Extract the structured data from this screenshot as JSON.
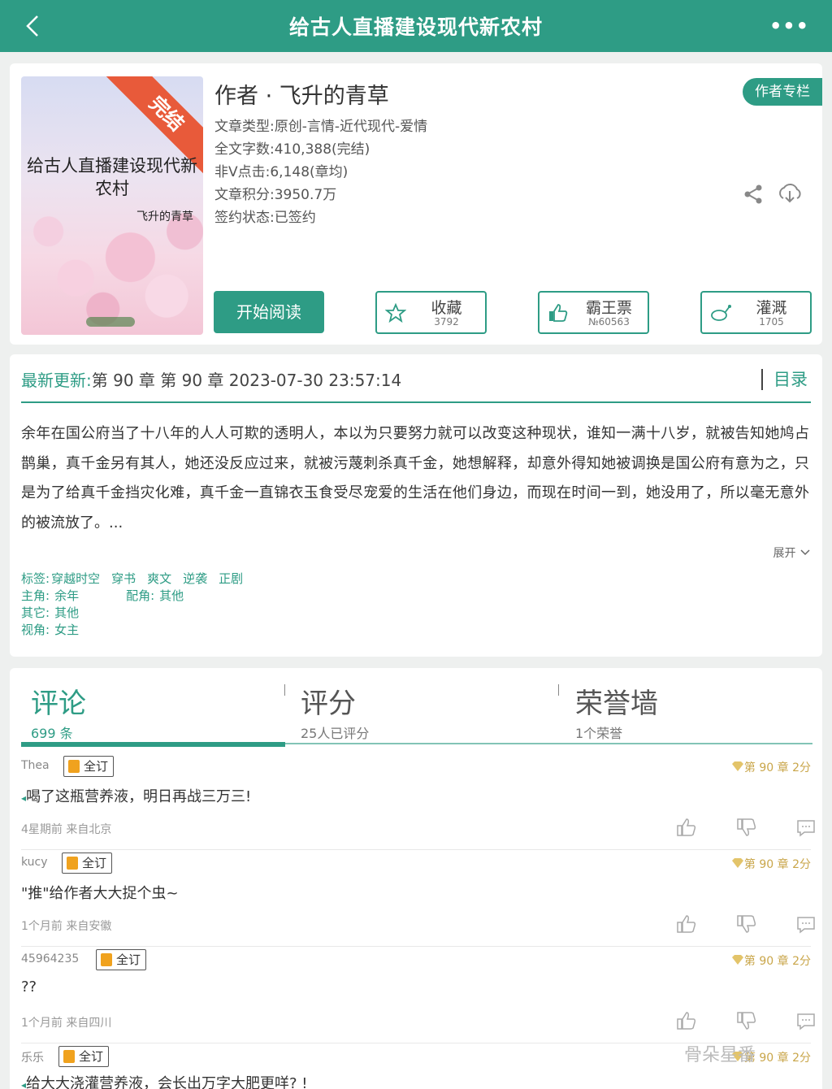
{
  "header": {
    "title": "给古人直播建设现代新农村",
    "back_icon": "chevron-left-icon",
    "more_label": "•••"
  },
  "book": {
    "cover_ribbon": "完结",
    "cover_title": "给古人直播建设现代新农村",
    "cover_author": "飞升的青草",
    "author_line": "作者 · 飞升的青草",
    "author_column_label": "作者专栏",
    "meta": [
      "文章类型:原创-言情-近代现代-爱情",
      "全文字数:410,388(完结)",
      "非V点击:6,148(章均)",
      "文章积分:3950.7万",
      "签约状态:已签约"
    ],
    "read_button": "开始阅读",
    "actions": [
      {
        "label": "收藏",
        "value": "3792",
        "icon": "star-icon"
      },
      {
        "label": "霸王票",
        "value": "№60563",
        "icon": "thumbs-up-icon"
      },
      {
        "label": "灌溉",
        "value": "1705",
        "icon": "watering-can-icon"
      }
    ]
  },
  "update": {
    "label": "最新更新:",
    "text": "第 90 章 第 90 章 2023-07-30 23:57:14",
    "toc": "目录",
    "summary": "余年在国公府当了十八年的人人可欺的透明人，本以为只要努力就可以改变这种现状，谁知一满十八岁，就被告知她鸠占鹊巢，真千金另有其人，她还没反应过来，就被污蔑刺杀真千金，她想解释，却意外得知她被调换是国公府有意为之，只是为了给真千金挡灾化难，真千金一直锦衣玉食受尽宠爱的生活在他们身边，而现在时间一到，她没用了，所以毫无意外的被流放了。...",
    "expand": "展开",
    "tags_label": "标签:",
    "tags": [
      "穿越时空",
      "穿书",
      "爽文",
      "逆袭",
      "正剧"
    ],
    "lead_label": "主角:",
    "lead": "余年",
    "support_label": "配角:",
    "support": "其他",
    "other_label": "其它:",
    "other": "其他",
    "view_label": "视角:",
    "view": "女主"
  },
  "tabs": [
    {
      "name": "评论",
      "sub": "699 条"
    },
    {
      "name": "评分",
      "sub": "25人已评分"
    },
    {
      "name": "荣誉墙",
      "sub": "1个荣誉"
    }
  ],
  "comments": [
    {
      "user": "Thea",
      "badge": "全订",
      "text": "喝了这瓶营养液，明日再战三万三!",
      "time": "4星期前  来自北京",
      "chapter": "第 90 章 2分"
    },
    {
      "user": "kucy",
      "badge": "全订",
      "text": "\"推\"给作者大大捉个虫~",
      "time": "1个月前  来自安徽",
      "chapter": "第 90 章 2分"
    },
    {
      "user": "45964235",
      "badge": "全订",
      "text": "??",
      "time": "1个月前  来自四川",
      "chapter": "第 90 章 2分"
    },
    {
      "user": "乐乐",
      "badge": "全订",
      "text": "给大大浇灌营养液，会长出万字大肥更咩? !",
      "time": "",
      "chapter": "第 90 章 2分"
    }
  ],
  "watermark": "骨朵星番"
}
